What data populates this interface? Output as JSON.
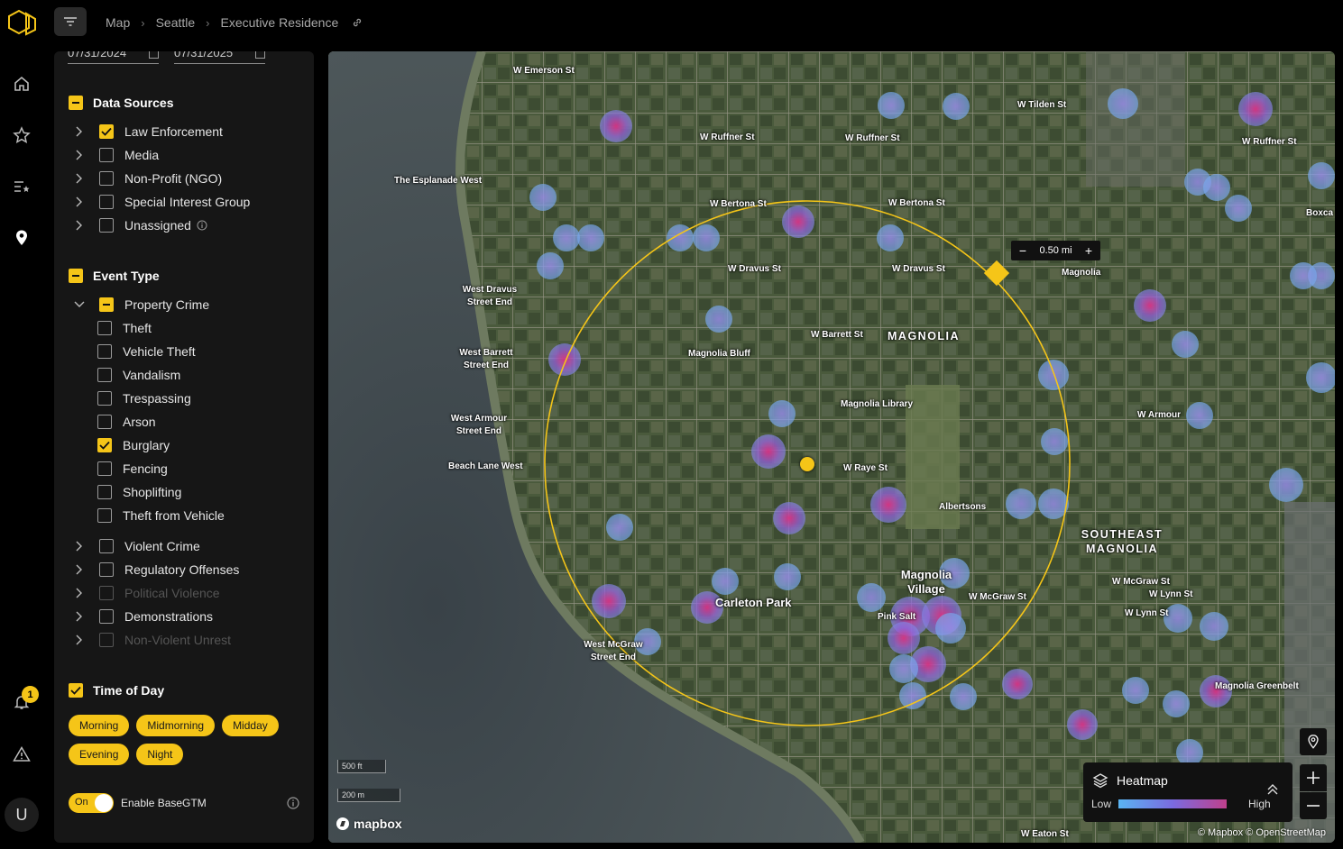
{
  "breadcrumb": {
    "items": [
      "Map",
      "Seattle",
      "Executive Residence"
    ]
  },
  "filters": {
    "date_start": "07/31/2024",
    "date_end": "07/31/2025",
    "data_sources": {
      "title": "Data Sources",
      "state": "partial",
      "items": [
        {
          "label": "Law Enforcement",
          "state": "checked"
        },
        {
          "label": "Media",
          "state": "empty"
        },
        {
          "label": "Non-Profit (NGO)",
          "state": "empty"
        },
        {
          "label": "Special Interest Group",
          "state": "empty"
        },
        {
          "label": "Unassigned",
          "state": "empty"
        }
      ]
    },
    "event_type": {
      "title": "Event Type",
      "state": "partial",
      "property_crime": {
        "label": "Property Crime",
        "state": "partial",
        "children": [
          {
            "label": "Theft",
            "state": "empty"
          },
          {
            "label": "Vehicle Theft",
            "state": "empty"
          },
          {
            "label": "Vandalism",
            "state": "empty"
          },
          {
            "label": "Trespassing",
            "state": "empty"
          },
          {
            "label": "Arson",
            "state": "empty"
          },
          {
            "label": "Burglary",
            "state": "checked"
          },
          {
            "label": "Fencing",
            "state": "empty"
          },
          {
            "label": "Shoplifting",
            "state": "empty"
          },
          {
            "label": "Theft from Vehicle",
            "state": "empty"
          }
        ]
      },
      "others": [
        {
          "label": "Violent Crime",
          "state": "empty"
        },
        {
          "label": "Regulatory Offenses",
          "state": "empty"
        },
        {
          "label": "Political Violence",
          "state": "disabled"
        },
        {
          "label": "Demonstrations",
          "state": "empty"
        },
        {
          "label": "Non-Violent Unrest",
          "state": "disabled"
        }
      ]
    },
    "time_of_day": {
      "title": "Time of Day",
      "state": "checked",
      "chips": [
        "Morning",
        "Midmorning",
        "Midday",
        "Evening",
        "Night"
      ]
    },
    "basegtm": {
      "toggle_label": "On",
      "label": "Enable BaseGTM"
    }
  },
  "notifications": {
    "count": "1"
  },
  "user": {
    "initial": "U"
  },
  "map": {
    "radius_label": "0.50 mi",
    "scale_ft": "500 ft",
    "scale_m": "200 m",
    "provider": "mapbox",
    "attribution": "© Mapbox © OpenStreetMap",
    "legend": {
      "title": "Heatmap",
      "low": "Low",
      "high": "High"
    },
    "labels": {
      "emerson": "W Emerson St",
      "ruffner1": "W Ruffner St",
      "ruffner2": "W Ruffner St",
      "ruffner3": "W Ruffner St",
      "tilden": "W Tilden St",
      "esplanade": "The Esplanade West",
      "bertona1": "W Bertona St",
      "bertona2": "W Bertona St",
      "dravus1": "W Dravus St",
      "dravus2": "W Dravus St",
      "magnolia_small": "Magnolia",
      "dravus_end": "West Dravus Street End",
      "barrett_end": "West Barrett Street End",
      "barrett": "W Barrett St",
      "magnolia_big": "MAGNOLIA",
      "bluff": "Magnolia Bluff",
      "library": "Magnolia Library",
      "armour_end": "West Armour Street End",
      "armour": "W Armour",
      "beach": "Beach Lane West",
      "raye": "W Raye St",
      "albertsons": "Albertsons",
      "southeast": "SOUTHEAST MAGNOLIA",
      "village": "Magnolia Village",
      "mcgraw": "W McGraw St",
      "mcgraw2": "W McGraw St",
      "carleton": "Carleton Park",
      "pinksalt": "Pink Salt",
      "lynn": "W Lynn St",
      "lynn2": "W Lynn St",
      "mcgraw_end": "West McGraw Street End",
      "greenbelt": "Magnolia Greenbelt",
      "eaton": "W Eaton St",
      "boxcar": "Boxca"
    }
  },
  "colors": {
    "accent": "#f5c518",
    "panel": "#161616",
    "heat_low": "#5ab4f2",
    "heat_high": "#c0408c"
  }
}
